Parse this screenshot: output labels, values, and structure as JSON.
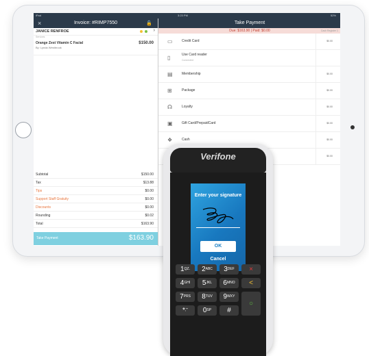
{
  "status": {
    "carrier": "iPad",
    "time": "3:23 PM",
    "battery": "52%"
  },
  "left": {
    "close": "×",
    "invoice": "Invoice: #RIMP7550",
    "customer": "JANICE RENFROE",
    "section": "Services",
    "item": {
      "name": "Orange Zest Vitamin C Facial",
      "by": "By: Lynda Westbrook",
      "price": "$150.00"
    },
    "totals": [
      {
        "label": "Subtotal",
        "value": "$150.00"
      },
      {
        "label": "Tax",
        "value": "$13.88"
      },
      {
        "label": "Tips",
        "value": "$0.00"
      },
      {
        "label": "Support Staff Gratuity",
        "value": "$0.00"
      },
      {
        "label": "Discounts",
        "value": "$0.00"
      },
      {
        "label": "Rounding",
        "value": "$0.02"
      },
      {
        "label": "Total",
        "value": "$163.90"
      }
    ],
    "take_label": "Take Payment",
    "take_value": "$163.90"
  },
  "right": {
    "title": "Take Payment",
    "due": "Due: $163.90 | Paid: $0.00",
    "cash_register": "Cash Register 1",
    "methods": [
      {
        "name": "Credit Card",
        "amount": "$0.00",
        "icon": "card-icon"
      },
      {
        "name": "Use Card reader",
        "sub": "Connected",
        "amount": "",
        "icon": "card-reader-icon"
      },
      {
        "name": "Membership",
        "amount": "$0.00",
        "icon": "membership-icon"
      },
      {
        "name": "Package",
        "amount": "$0.00",
        "icon": "package-icon"
      },
      {
        "name": "Loyalty",
        "amount": "$0.00",
        "icon": "loyalty-icon"
      },
      {
        "name": "Gift Card/PrepaidCard",
        "amount": "$0.00",
        "icon": "gift-card-icon"
      },
      {
        "name": "Cash",
        "amount": "$0.00",
        "icon": "cash-icon"
      },
      {
        "name": "",
        "amount": "$0.00",
        "icon": "other-icon"
      }
    ]
  },
  "terminal": {
    "brand": "Verifone",
    "prompt": "Enter your signature",
    "ok": "OK",
    "cancel": "Cancel",
    "keys": [
      {
        "num": "1",
        "sub": "QZ."
      },
      {
        "num": "2",
        "sub": "ABC"
      },
      {
        "num": "3",
        "sub": "DEF"
      },
      {
        "num": "×",
        "sub": ""
      },
      {
        "num": "4",
        "sub": "GHI"
      },
      {
        "num": "5",
        "sub": "JKL"
      },
      {
        "num": "6",
        "sub": "MNO"
      },
      {
        "num": "<",
        "sub": ""
      },
      {
        "num": "7",
        "sub": "PRS"
      },
      {
        "num": "8",
        "sub": "TUV"
      },
      {
        "num": "9",
        "sub": "WXY"
      },
      {
        "num": "○",
        "sub": ""
      },
      {
        "num": "*",
        "sub": ",'\""
      },
      {
        "num": "0",
        "sub": "SP"
      },
      {
        "num": "#",
        "sub": ""
      }
    ]
  }
}
